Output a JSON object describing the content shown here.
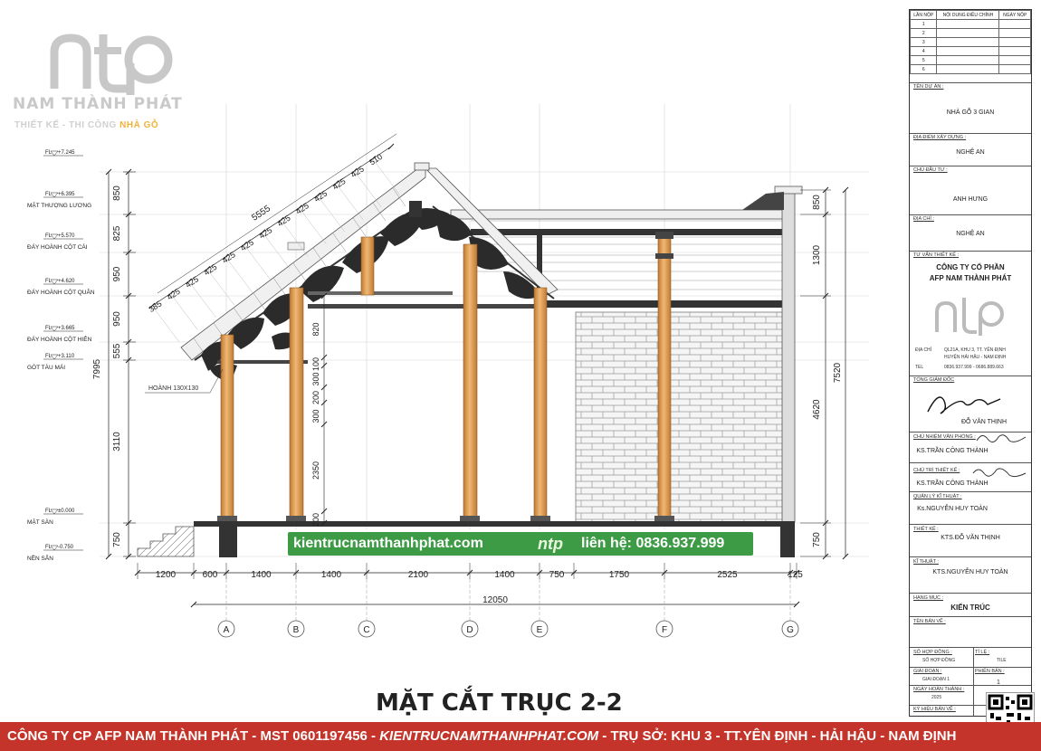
{
  "logo": {
    "mark": "ntp",
    "company": "NAM THÀNH PHÁT",
    "tagline_1": "THIẾT KẾ - THI CÔNG",
    "tagline_2": "NHÀ GỖ"
  },
  "drawing_title": "MẶT CẮT TRỤC 2-2",
  "levels": [
    {
      "fl": "FL",
      "value": "+7.245",
      "name": ""
    },
    {
      "fl": "FL",
      "value": "+6.395",
      "name": "MẶT THƯỢNG LƯƠNG"
    },
    {
      "fl": "FL",
      "value": "+5.570",
      "name": "ĐÁY HOÀNH CỘT CÁI"
    },
    {
      "fl": "FL",
      "value": "+4.620",
      "name": "ĐÁY HOÀNH CỘT QUÂN"
    },
    {
      "fl": "FL",
      "value": "+3.665",
      "name": "ĐÁY HOÀNH CỘT HIÊN"
    },
    {
      "fl": "FL",
      "value": "+3.110",
      "name": "GÓT TÀU MÁI"
    },
    {
      "fl": "FL",
      "value": "±0.000",
      "name": "MẶT SÀN"
    },
    {
      "fl": "FL",
      "value": "-0.750",
      "name": "NỀN SÂN"
    }
  ],
  "left_dims": [
    "850",
    "825",
    "950",
    "950",
    "555",
    "3110",
    "750"
  ],
  "left_total": "7995",
  "right_dims": [
    "850",
    "1300",
    "4620",
    "750"
  ],
  "right_total": "7520",
  "roof_dims": [
    "385",
    "425",
    "425",
    "425",
    "425",
    "425",
    "425",
    "425",
    "425",
    "425",
    "425",
    "425",
    "510"
  ],
  "roof_total": "5555",
  "inner_dims": [
    "820",
    "100",
    "300",
    "200",
    "300",
    "2350",
    "200"
  ],
  "hoanh_label": "HOÀNH 130X130",
  "bottom_dims": [
    "1200",
    "600",
    "1400",
    "1400",
    "2100",
    "1400",
    "750",
    "1750",
    "2525",
    "125"
  ],
  "bottom_total": "12050",
  "axes": [
    "A",
    "B",
    "C",
    "D",
    "E",
    "F",
    "G"
  ],
  "watermark": {
    "site": "kientrucnamthanhphat.com",
    "logo": "ntp",
    "contact": "liên hệ: 0836.937.999"
  },
  "footer": {
    "text_a": "CÔNG TY CP AFP NAM THÀNH PHÁT - MST 0601197456 - ",
    "web": "KIENTRUCNAMTHANHPHAT.COM",
    "text_b": " - TRỤ SỞ: KHU 3 - TT.YÊN ĐỊNH - HẢI HẬU - NAM ĐỊNH"
  },
  "title_block": {
    "rev_headers": [
      "LẦN NỘP",
      "NỘI DUNG ĐIỀU CHỈNH",
      "NGÀY NỘP"
    ],
    "rev_rows": [
      "1",
      "2",
      "3",
      "4",
      "5",
      "6"
    ],
    "project_label": "TÊN DỰ ÁN :",
    "project": "NHÀ GỖ 3 GIAN",
    "location_label": "ĐỊA ĐIỂM XÂY DỰNG :",
    "location": "NGHỆ AN",
    "owner_label": "CHỦ ĐẦU TƯ :",
    "owner": "ANH HƯNG",
    "address_label": "ĐỊA CHỈ :",
    "address": "NGHỆ AN",
    "designer_label": "TƯ VẤN THIẾT KẾ :",
    "designer_1": "CÔNG TY CỔ PHẦN",
    "designer_2": "AFP NAM THÀNH PHÁT",
    "addr_key": "ĐỊA CHỈ",
    "addr_1": "QL21A, KHU 3, TT. YÊN ĐỊNH",
    "addr_2": "HUYỆN HẢI HẬU - NAM ĐỊNH",
    "tel_key": "TEL",
    "tel": "0836.937.999 - 0686.889.663",
    "director_label": "TỔNG GIÁM ĐỐC",
    "director": "ĐỖ VĂN THỊNH",
    "office_label": "CHỦ NHIỆM VĂN PHÒNG :",
    "office": "KS.TRẦN CÔNG THÀNH",
    "lead_label": "CHỦ TRÌ THIẾT KẾ :",
    "lead": "KS.TRẦN CÔNG THÀNH",
    "qa_label": "QUẢN LÝ KĨ THUẬT :",
    "qa": "Ks.NGUYỄN HUY TOÀN",
    "design_label": "THIẾT KẾ :",
    "design": "KTS.ĐỖ VĂN THỊNH",
    "tech_label": "KĨ THUẬT :",
    "tech": "KTS.NGUYỄN HUY TOÀN",
    "item_label": "HẠNG MỤC :",
    "item": "KIẾN TRÚC",
    "sheetname_label": "TÊN BẢN VẼ :",
    "contract_label": "SỐ HỢP ĐỒNG :",
    "contract": "SỐ HỢP ĐỒNG",
    "scale_label": "TỈ LỆ :",
    "scale": "TILE",
    "phase_label": "GIAI ĐOẠN :",
    "phase": "GIAI ĐOẠN 1",
    "version_label": "PHIÊN BẢN :",
    "version": "1",
    "date_label": "NGÀY HOÀN THÀNH :",
    "date": "2025",
    "sym_label": "KÝ HIỆU BẢN VẼ :"
  },
  "colors": {
    "wood": "#e8a85a",
    "wood_dark": "#b87a35",
    "carving": "#2b2b2b",
    "brick": "#f4f4f4",
    "footer_bg": "#c4342a",
    "watermark_bg": "#3d9b45",
    "logo_accent": "#f2b33d"
  }
}
